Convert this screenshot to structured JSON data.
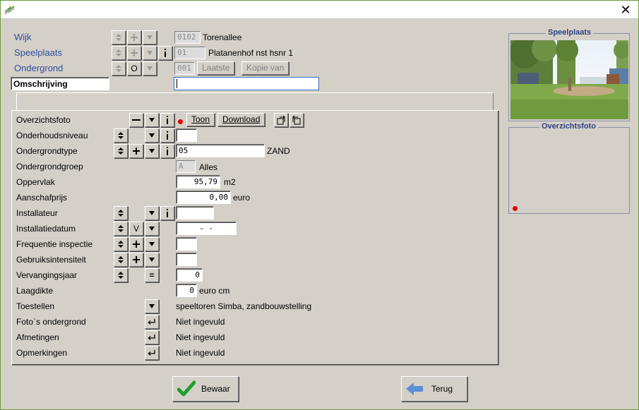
{
  "titlebar": {
    "close_glyph": "✕"
  },
  "header": {
    "wijk": {
      "label": "Wijk",
      "code": "0102",
      "name": "Torenallee"
    },
    "speelplaats": {
      "label": "Speelplaats",
      "code": "01",
      "name": "Platanenhof nst hsnr 1"
    },
    "ondergrond": {
      "label": "Ondergrond",
      "code": "001",
      "btn_laatste": "Laatste",
      "btn_kopie": "Kopie van",
      "mid_btn": "O"
    },
    "omschrijving": {
      "label": "Omschrijving",
      "value": ""
    }
  },
  "rows": {
    "overzichtsfoto": {
      "label": "Overzichtsfoto",
      "btn_toon": "Toon",
      "btn_download": "Download"
    },
    "onderhoudsniveau": {
      "label": "Onderhoudsniveau",
      "value": ""
    },
    "ondergrondtype": {
      "label": "Ondergrondtype",
      "value": "05",
      "desc": "ZAND"
    },
    "ondergrondgroep": {
      "label": "Ondergrondgroep",
      "code": "A",
      "desc": "Alles"
    },
    "oppervlak": {
      "label": "Oppervlak",
      "value": "95,79",
      "unit": "m2"
    },
    "aanschafprijs": {
      "label": "Aanschafprijs",
      "value": "0,00",
      "unit": "euro"
    },
    "installateur": {
      "label": "Installateur",
      "value": ""
    },
    "installatiedatum": {
      "label": "Installatiedatum",
      "value": "-  -",
      "btn": "V"
    },
    "frequentie": {
      "label": "Frequentie inspectie",
      "value": ""
    },
    "gebruiksintensiteit": {
      "label": "Gebruiksintensiteit",
      "value": ""
    },
    "vervangingsjaar": {
      "label": "Vervangingsjaar",
      "value": "0",
      "btn": "="
    },
    "laagdikte": {
      "label": "Laagdikte",
      "value": "0",
      "unit": "euro cm"
    },
    "toestellen": {
      "label": "Toestellen",
      "value": "speeltoren Simba, zandbouwstelling"
    },
    "fotos": {
      "label": "Foto`s ondergrond",
      "value": "Niet ingevuld"
    },
    "afmetingen": {
      "label": "Afmetingen",
      "value": "Niet ingevuld"
    },
    "opmerkingen": {
      "label": "Opmerkingen",
      "value": "Niet ingevuld"
    }
  },
  "side": {
    "speelplaats_title": "Speelplaats",
    "overzichtsfoto_title": "Overzichtsfoto"
  },
  "footer": {
    "save_label": "Bewaar",
    "back_label": "Terug"
  },
  "colors": {
    "accent_blue": "#2f4f9f",
    "red_dot": "#e00000",
    "check_green": "#1e9e2a",
    "arrow_blue": "#5b8fd6"
  }
}
